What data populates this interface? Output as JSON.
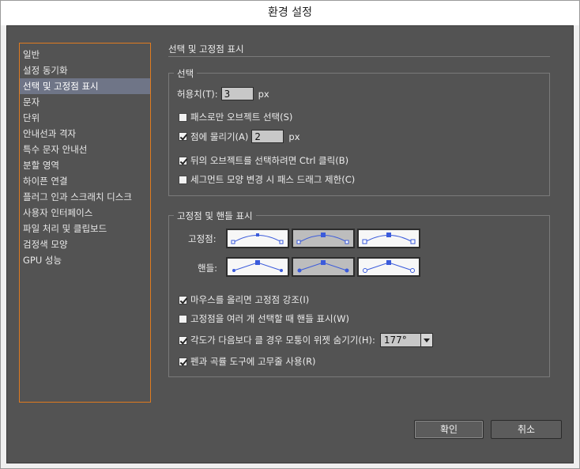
{
  "window": {
    "title": "환경 설정"
  },
  "sidebar": {
    "items": [
      {
        "label": "일반"
      },
      {
        "label": "설정 동기화"
      },
      {
        "label": "선택 및 고정점 표시",
        "selected": true
      },
      {
        "label": "문자"
      },
      {
        "label": "단위"
      },
      {
        "label": "안내선과 격자"
      },
      {
        "label": "특수 문자 안내선"
      },
      {
        "label": "분할 영역"
      },
      {
        "label": "하이픈 연결"
      },
      {
        "label": "플러그 인과 스크래치 디스크"
      },
      {
        "label": "사용자 인터페이스"
      },
      {
        "label": "파일 처리 및 클립보드"
      },
      {
        "label": "검정색 모양"
      },
      {
        "label": "GPU 성능"
      }
    ]
  },
  "panel": {
    "title": "선택 및 고정점 표시",
    "selection": {
      "legend": "선택",
      "tolerance_label": "허용치(T):",
      "tolerance_value": "3",
      "tolerance_unit": "px",
      "path_only_label": "패스로만 오브젝트 선택(S)",
      "path_only_checked": false,
      "snap_label": "점에 물리기(A)",
      "snap_checked": true,
      "snap_value": "2",
      "snap_unit": "px",
      "ctrl_click_label": "뒤의 오브젝트를 선택하려면 Ctrl 클릭(B)",
      "ctrl_click_checked": true,
      "constrain_label": "세그먼트 모양 변경 시 패스 드래그 제한(C)",
      "constrain_checked": false
    },
    "anchor_display": {
      "legend": "고정점 및 핸들 표시",
      "anchor_label": "고정점:",
      "anchor_selected_index": 1,
      "handle_label": "핸들:",
      "handle_selected_index": 1,
      "highlight_label": "마우스를 올리면 고정점 강조(I)",
      "highlight_checked": true,
      "show_handles_label": "고정점을 여러 개 선택할 때 핸들 표시(W)",
      "show_handles_checked": false,
      "hide_widget_label": "각도가 다음보다 클 경우 모퉁이 위젯 숨기기(H):",
      "hide_widget_checked": true,
      "angle_value": "177°",
      "rubber_band_label": "펜과 곡률 도구에 고무줄 사용(R)",
      "rubber_band_checked": true
    }
  },
  "buttons": {
    "ok": "확인",
    "cancel": "취소"
  },
  "colors": {
    "accent": "#e07b1f",
    "selection": "#6f7587",
    "anchor_blue": "#3b5bdb"
  }
}
